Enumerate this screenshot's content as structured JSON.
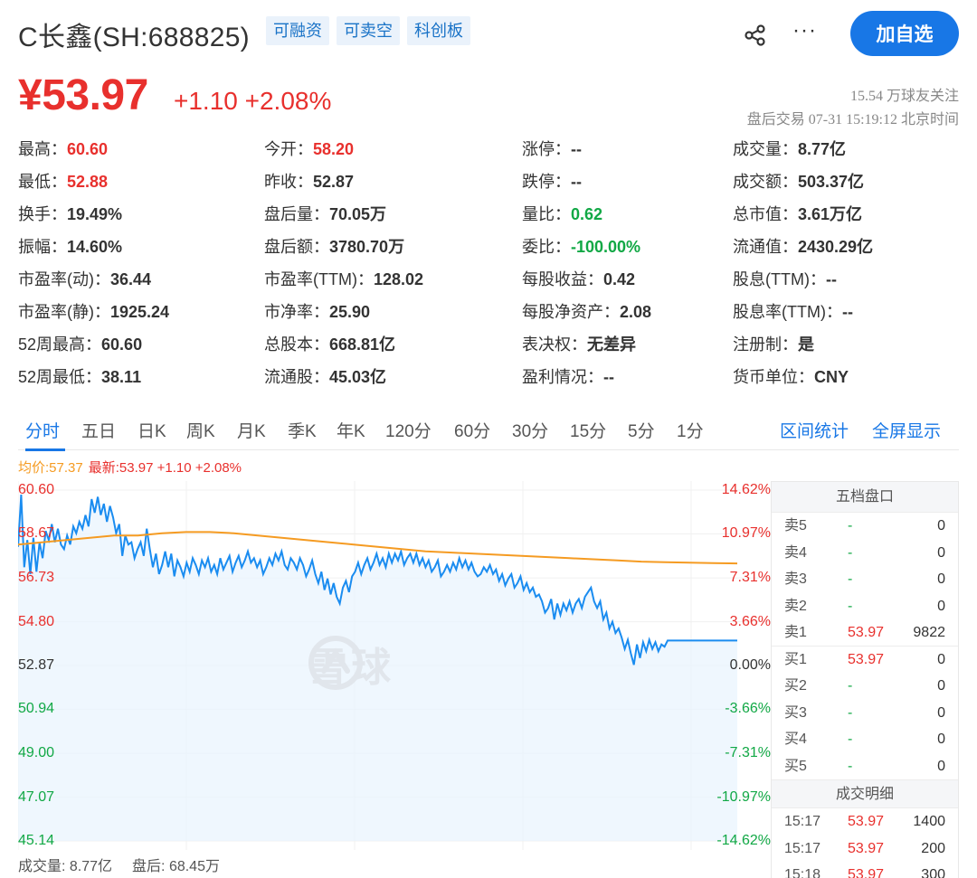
{
  "header": {
    "title": "C长鑫(SH:688825)",
    "tags": [
      "可融资",
      "可卖空",
      "科创板"
    ],
    "more_label": "···",
    "follow_label": "加自选"
  },
  "price": {
    "current": "¥53.97",
    "change": "+1.10 +2.08%",
    "followers": "15.54 万球友关注",
    "trade_time": "盘后交易 07-31 15:19:12 北京时间"
  },
  "quote": {
    "rows": [
      [
        {
          "k": "最高：",
          "v": "60.60",
          "c": "up"
        },
        {
          "k": "今开：",
          "v": "58.20",
          "c": "up"
        },
        {
          "k": "涨停：",
          "v": "--",
          "c": ""
        },
        {
          "k": "成交量：",
          "v": "8.77亿",
          "c": ""
        }
      ],
      [
        {
          "k": "最低：",
          "v": "52.88",
          "c": "up"
        },
        {
          "k": "昨收：",
          "v": "52.87",
          "c": ""
        },
        {
          "k": "跌停：",
          "v": "--",
          "c": ""
        },
        {
          "k": "成交额：",
          "v": "503.37亿",
          "c": ""
        }
      ],
      [
        {
          "k": "换手：",
          "v": "19.49%",
          "c": ""
        },
        {
          "k": "盘后量：",
          "v": "70.05万",
          "c": ""
        },
        {
          "k": "量比：",
          "v": "0.62",
          "c": "down"
        },
        {
          "k": "总市值：",
          "v": "3.61万亿",
          "c": ""
        }
      ],
      [
        {
          "k": "振幅：",
          "v": "14.60%",
          "c": ""
        },
        {
          "k": "盘后额：",
          "v": "3780.70万",
          "c": ""
        },
        {
          "k": "委比：",
          "v": "-100.00%",
          "c": "down"
        },
        {
          "k": "流通值：",
          "v": "2430.29亿",
          "c": ""
        }
      ],
      [
        {
          "k": "市盈率(动)：",
          "v": "36.44",
          "c": ""
        },
        {
          "k": "市盈率(TTM)：",
          "v": "128.02",
          "c": ""
        },
        {
          "k": "每股收益：",
          "v": "0.42",
          "c": ""
        },
        {
          "k": "股息(TTM)：",
          "v": "--",
          "c": ""
        }
      ],
      [
        {
          "k": "市盈率(静)：",
          "v": "1925.24",
          "c": ""
        },
        {
          "k": "市净率：",
          "v": "25.90",
          "c": ""
        },
        {
          "k": "每股净资产：",
          "v": "2.08",
          "c": ""
        },
        {
          "k": "股息率(TTM)：",
          "v": "--",
          "c": ""
        }
      ],
      [
        {
          "k": "52周最高：",
          "v": "60.60",
          "c": ""
        },
        {
          "k": "总股本：",
          "v": "668.81亿",
          "c": ""
        },
        {
          "k": "表决权：",
          "v": "无差异",
          "c": ""
        },
        {
          "k": "注册制：",
          "v": "是",
          "c": ""
        }
      ],
      [
        {
          "k": "52周最低：",
          "v": "38.11",
          "c": ""
        },
        {
          "k": "流通股：",
          "v": "45.03亿",
          "c": ""
        },
        {
          "k": "盈利情况：",
          "v": "--",
          "c": ""
        },
        {
          "k": "货币单位：",
          "v": "CNY",
          "c": ""
        }
      ]
    ]
  },
  "tabs": {
    "items": [
      "分时",
      "五日",
      "日K",
      "周K",
      "月K",
      "季K",
      "年K",
      "120分",
      "60分",
      "30分",
      "15分",
      "5分",
      "1分"
    ],
    "right": [
      "区间统计",
      "全屏显示"
    ]
  },
  "legend": {
    "avg": "均价:57.37",
    "last": "最新:53.97 +1.10 +2.08%"
  },
  "chart_data": {
    "type": "line",
    "y_left_ticks": [
      "60.60",
      "58.67",
      "56.73",
      "54.80",
      "52.87",
      "50.94",
      "49.00",
      "47.07",
      "45.14"
    ],
    "y_right_ticks": [
      "14.62%",
      "10.97%",
      "7.31%",
      "3.66%",
      "0.00%",
      "-3.66%",
      "-7.31%",
      "-10.97%",
      "-14.62%"
    ],
    "ylim": [
      45.14,
      60.6
    ],
    "prev_close": 52.87,
    "series": [
      {
        "values": [
          58.1,
          60.4,
          57.2,
          58.4,
          56.9,
          58.5,
          57.0,
          58.3,
          57.6,
          58.8,
          58.4,
          59.1,
          58.3,
          58.9,
          58.2,
          58.0,
          58.6,
          58.2,
          59.0,
          58.7,
          59.2,
          58.9,
          59.5,
          59.0,
          60.2,
          59.6,
          60.3,
          59.5,
          60.0,
          59.2,
          59.9,
          59.4,
          58.7,
          59.1,
          57.7,
          58.6,
          58.2,
          58.3,
          57.6,
          58.0,
          58.3,
          57.7,
          58.9,
          58.0,
          57.2,
          57.8,
          56.9,
          57.3,
          57.9,
          57.2,
          57.8,
          56.8,
          57.5,
          57.2,
          56.8,
          57.4,
          57.0,
          57.6,
          57.3,
          56.9,
          57.5,
          57.2,
          57.6,
          57.0,
          57.3,
          56.9,
          57.6,
          57.1,
          57.4,
          57.7,
          57.0,
          57.4,
          57.7,
          57.2,
          57.5,
          57.9,
          57.4,
          57.6,
          57.2,
          57.5,
          56.9,
          57.2,
          57.6,
          57.3,
          57.8,
          57.5,
          57.9,
          57.3,
          57.1,
          57.6,
          57.4,
          57.1,
          57.6,
          57.3,
          56.8,
          57.1,
          57.5,
          56.9,
          56.5,
          57.0,
          56.2,
          56.7,
          56.0,
          56.5,
          55.9,
          55.6,
          56.3,
          56.6,
          56.1,
          56.8,
          57.0,
          57.4,
          56.9,
          57.3,
          57.6,
          57.1,
          57.4,
          57.8,
          57.3,
          57.6,
          57.2,
          57.8,
          57.4,
          57.8,
          57.5,
          57.9,
          57.3,
          57.6,
          57.8,
          57.4,
          57.8,
          57.3,
          57.6,
          57.2,
          57.5,
          57.0,
          57.2,
          57.5,
          56.8,
          57.0,
          57.3,
          57.0,
          57.4,
          57.1,
          57.6,
          57.2,
          57.5,
          57.1,
          57.4,
          57.0,
          56.8,
          56.9,
          57.2,
          57.0,
          57.3,
          56.9,
          57.1,
          56.6,
          56.9,
          56.4,
          56.7,
          56.9,
          56.3,
          56.5,
          56.8,
          56.2,
          56.5,
          56.1,
          56.3,
          55.9,
          56.0,
          55.7,
          55.2,
          55.4,
          55.8,
          54.9,
          55.6,
          55.1,
          55.6,
          55.3,
          55.7,
          55.2,
          55.6,
          55.8,
          55.4,
          55.9,
          56.1,
          56.3,
          55.7,
          55.4,
          55.7,
          54.9,
          55.2,
          54.5,
          54.8,
          54.3,
          54.5,
          54.1,
          53.6,
          54.0,
          53.4,
          52.9,
          53.8,
          53.2,
          53.9,
          53.5,
          54.0,
          53.6,
          53.9,
          53.5,
          53.8,
          53.7,
          53.97
        ]
      },
      {
        "name": "均价",
        "values": [
          58.2,
          58.3,
          58.4,
          58.5,
          58.6,
          58.6,
          58.7,
          58.75,
          58.75,
          58.7,
          58.6,
          58.5,
          58.4,
          58.3,
          58.2,
          58.1,
          58.0,
          57.9,
          57.85,
          57.8,
          57.75,
          57.7,
          57.65,
          57.6,
          57.55,
          57.5,
          57.45,
          57.42,
          57.4,
          57.38,
          57.37
        ]
      }
    ]
  },
  "watermark": "雪球",
  "volume_row": {
    "volume": "成交量: 8.77亿",
    "after": "盘后: 68.45万"
  },
  "orderbook": {
    "title": "五档盘口",
    "rows": [
      {
        "label": "卖5",
        "price": "-",
        "qty": "0"
      },
      {
        "label": "卖4",
        "price": "-",
        "qty": "0"
      },
      {
        "label": "卖3",
        "price": "-",
        "qty": "0"
      },
      {
        "label": "卖2",
        "price": "-",
        "qty": "0"
      },
      {
        "label": "卖1",
        "price": "53.97",
        "qty": "9822"
      },
      {
        "label": "买1",
        "price": "53.97",
        "qty": "0"
      },
      {
        "label": "买2",
        "price": "-",
        "qty": "0"
      },
      {
        "label": "买3",
        "price": "-",
        "qty": "0"
      },
      {
        "label": "买4",
        "price": "-",
        "qty": "0"
      },
      {
        "label": "买5",
        "price": "-",
        "qty": "0"
      }
    ],
    "detail_title": "成交明细",
    "trades": [
      {
        "time": "15:17",
        "price": "53.97",
        "qty": "1400"
      },
      {
        "time": "15:17",
        "price": "53.97",
        "qty": "200"
      },
      {
        "time": "15:18",
        "price": "53.97",
        "qty": "300"
      }
    ]
  },
  "colors": {
    "up": "#e8302d",
    "down": "#11a845",
    "accent": "#1877e6",
    "avg_line": "#f59b22",
    "price_line": "#1a8cf0"
  }
}
